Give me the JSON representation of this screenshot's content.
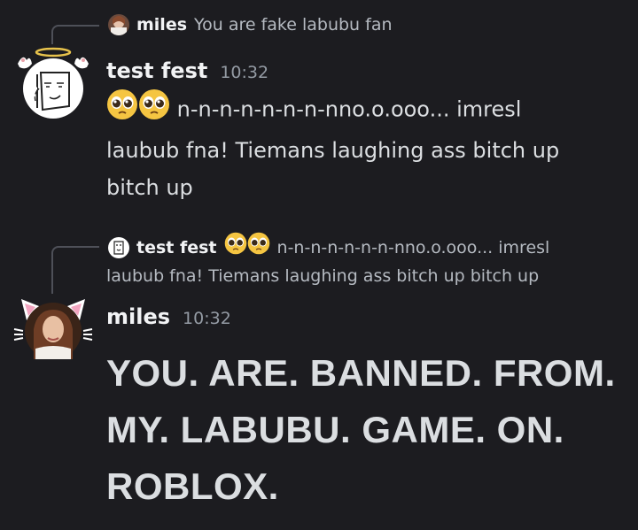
{
  "messages": [
    {
      "reply": {
        "author": "miles",
        "text": "You are fake labubu fan"
      },
      "author": "test fest",
      "timestamp": "10:32",
      "text_line1": "n-n-n-n-n-n-n-nno.o.ooo... imresl",
      "text_line2": "laubub fna! Tiemans laughing ass bitch up",
      "text_line3": "bitch up",
      "avatar": "angel-doodle-avatar",
      "emoji": "pleading-face-emoji"
    },
    {
      "reply": {
        "author": "test fest",
        "text_line1": "n-n-n-n-n-n-n-nno.o.ooo... imresl",
        "text_line2": "laubub fna! Tiemans laughing ass bitch up bitch up"
      },
      "author": "miles",
      "timestamp": "10:32",
      "heading_line1": "YOU. ARE. BANNED. FROM.",
      "heading_line2": "MY. LABUBU. GAME. ON.",
      "heading_line3": "ROBLOX.",
      "avatar": "cat-ears-photo-avatar"
    }
  ],
  "colors": {
    "background": "#1c1c20",
    "text": "#dbdee1",
    "muted": "#949ba4",
    "author": "#f2f3f5"
  }
}
